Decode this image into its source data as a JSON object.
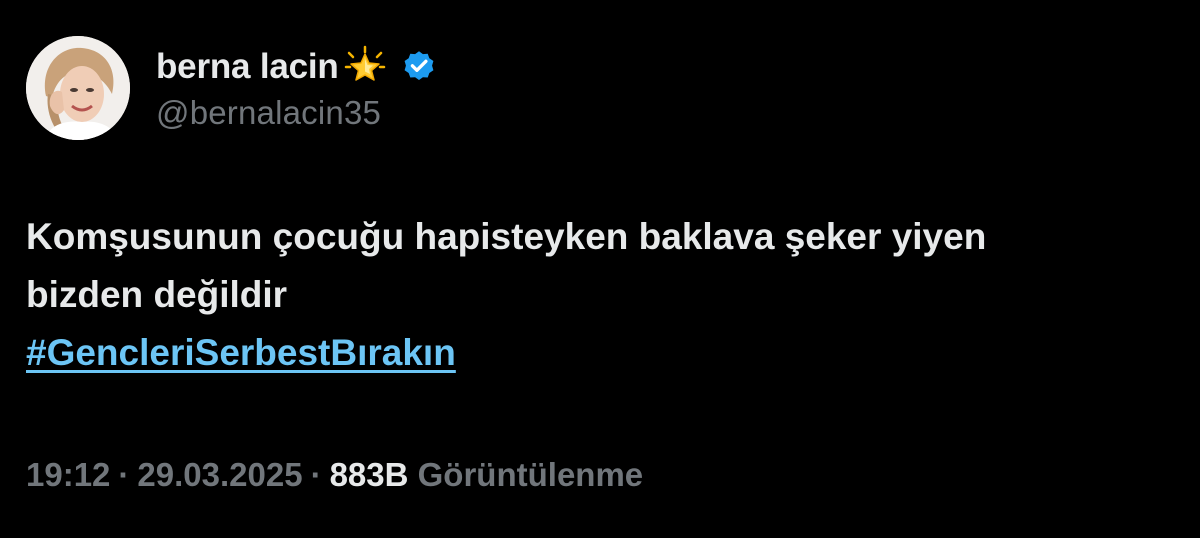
{
  "user": {
    "display_name": "berna lacin",
    "handle": "@bernalacin35",
    "avatar_icon": "profile-photo",
    "badge_icon": "glowing-star-emoji",
    "verified_icon": "verified-badge-icon",
    "verified_color": "#1d9bf0"
  },
  "tweet": {
    "line1": "Komşusunun çocuğu hapisteyken baklava şeker yiyen",
    "line2": "bizden değildir",
    "hashtag": "#GencleriSerbestBırakın",
    "hashtag_color": "#6cc5f5"
  },
  "meta": {
    "time": "19:12",
    "separator": "·",
    "date": "29.03.2025",
    "views_count": "883B",
    "views_label": "Görüntülenme"
  }
}
